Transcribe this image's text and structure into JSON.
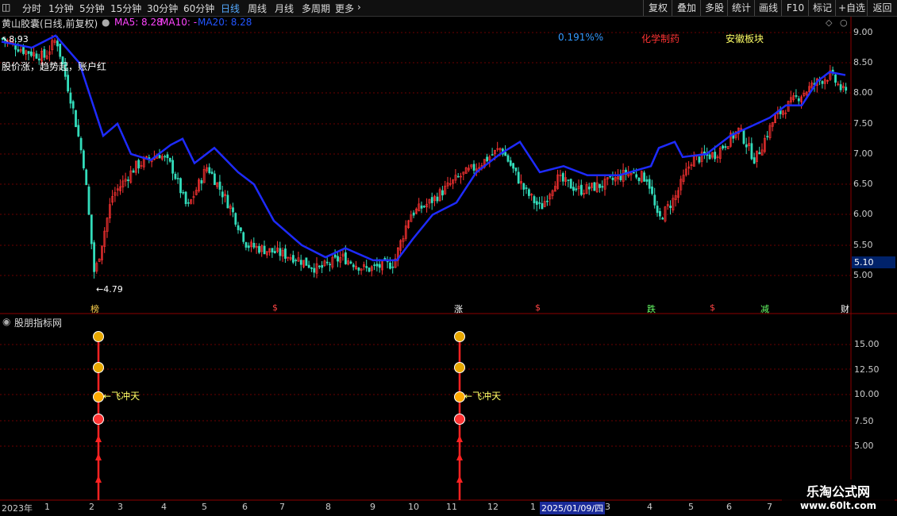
{
  "toolbar": {
    "left": [
      "分时",
      "1分钟",
      "5分钟",
      "15分钟",
      "30分钟",
      "60分钟",
      "日线",
      "周线",
      "月线",
      "多周期",
      "更多"
    ],
    "active": "日线",
    "right": [
      "复权",
      "叠加",
      "多股",
      "统计",
      "画线",
      "F10",
      "标记",
      "+自选",
      "返回"
    ]
  },
  "header": {
    "stock": "黄山胶囊(日线,前复权)",
    "ma5": "MA5: 8.28",
    "ma10": "MA10: -",
    "ma20": "MA20: 8.28"
  },
  "main": {
    "high_label": "8.93",
    "low_label": "4.79",
    "comment": "股价涨，趋势起，账户红",
    "percent": "0.191%%",
    "sector1": "化学制药",
    "sector2": "安徽板块",
    "price_tag": "5.10",
    "y_ticks": [
      "9.00",
      "8.50",
      "8.00",
      "7.50",
      "7.00",
      "6.50",
      "6.00",
      "5.50",
      "5.00"
    ],
    "markers": [
      {
        "text": "榜",
        "color": "#ffd34d"
      },
      {
        "text": "$",
        "color": "#ff4444"
      },
      {
        "text": "涨",
        "color": "#ffffff"
      },
      {
        "text": "$",
        "color": "#ff4444"
      },
      {
        "text": "跌",
        "color": "#66ff66"
      },
      {
        "text": "$",
        "color": "#ff4444"
      },
      {
        "text": "减",
        "color": "#66ff66"
      },
      {
        "text": "财",
        "color": "#ffffff"
      }
    ]
  },
  "sub": {
    "title": "股朋指标网",
    "signal_label": "飞冲天",
    "y_ticks": [
      "15.00",
      "12.50",
      "10.00",
      "7.50",
      "5.00"
    ]
  },
  "xaxis": {
    "labels": [
      "2023年",
      "1",
      "2",
      "3",
      "4",
      "5",
      "6",
      "7",
      "8",
      "9",
      "10",
      "11",
      "12",
      "1",
      "2025/01/09/四",
      "3",
      "4",
      "5",
      "6",
      "7"
    ]
  },
  "watermark": {
    "line1": "乐淘公式网",
    "line2": "www.60lt.com"
  },
  "colors": {
    "up": "#ff3333",
    "down": "#33ddbb",
    "ma": "#2233ff",
    "grid": "#6b0000"
  }
}
